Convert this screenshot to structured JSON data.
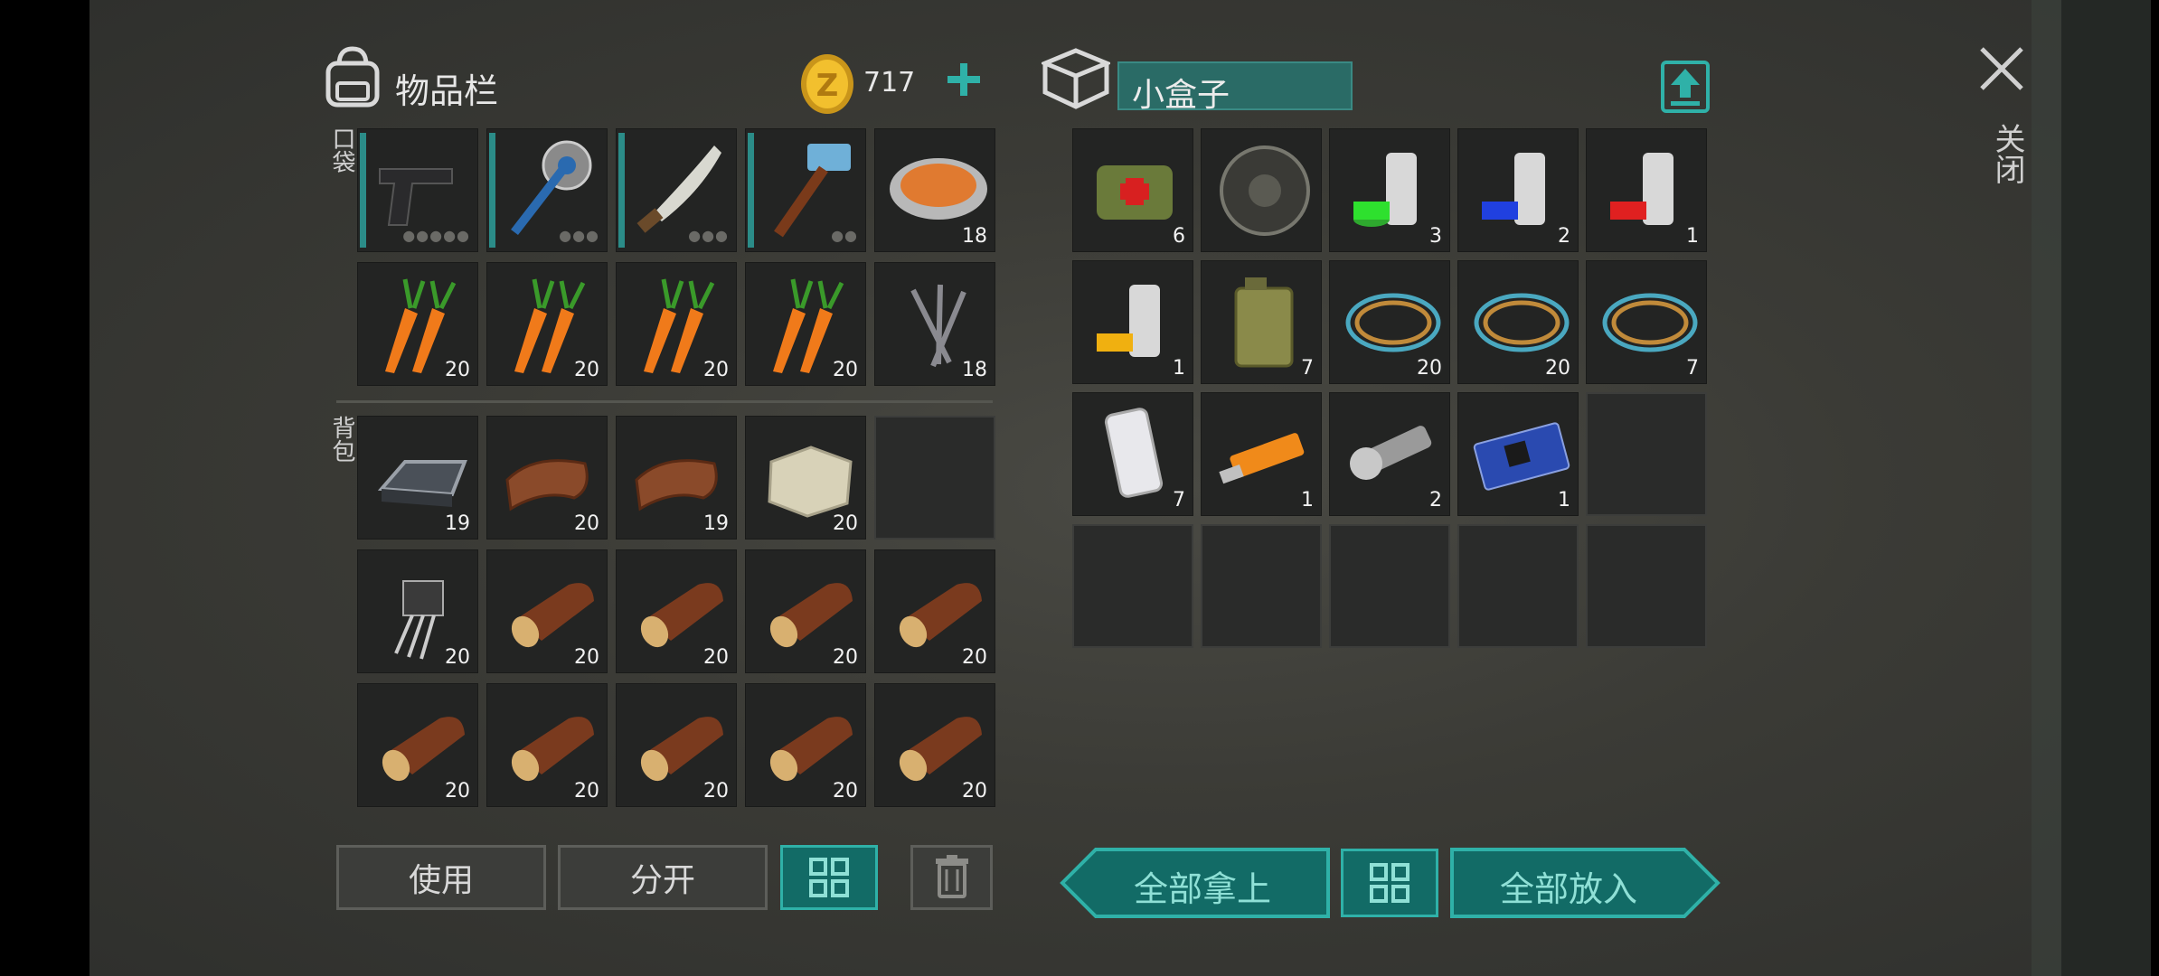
{
  "inventory": {
    "title": "物品栏",
    "coins": "717",
    "pocket_label": "口袋",
    "backpack_label": "背包",
    "pocket": [
      {
        "icon": "pistol-icon",
        "count": ""
      },
      {
        "icon": "saw-blade-mace-icon",
        "count": ""
      },
      {
        "icon": "machete-icon",
        "count": ""
      },
      {
        "icon": "hammer-icon",
        "count": ""
      },
      {
        "icon": "stew-bowl-icon",
        "count": "18"
      },
      {
        "icon": "carrot-icon",
        "count": "20"
      },
      {
        "icon": "carrot-icon",
        "count": "20"
      },
      {
        "icon": "carrot-icon",
        "count": "20"
      },
      {
        "icon": "carrot-icon",
        "count": "20"
      },
      {
        "icon": "nails-icon",
        "count": "18"
      }
    ],
    "backpack": [
      {
        "icon": "iron-ingot-icon",
        "count": "19"
      },
      {
        "icon": "leather-icon",
        "count": "20"
      },
      {
        "icon": "leather-icon",
        "count": "19"
      },
      {
        "icon": "stone-block-icon",
        "count": "20"
      },
      {
        "icon": "",
        "count": ""
      },
      {
        "icon": "transistor-icon",
        "count": "20"
      },
      {
        "icon": "log-icon",
        "count": "20"
      },
      {
        "icon": "log-icon",
        "count": "20"
      },
      {
        "icon": "log-icon",
        "count": "20"
      },
      {
        "icon": "log-icon",
        "count": "20"
      },
      {
        "icon": "log-icon",
        "count": "20"
      },
      {
        "icon": "log-icon",
        "count": "20"
      },
      {
        "icon": "log-icon",
        "count": "20"
      },
      {
        "icon": "log-icon",
        "count": "20"
      },
      {
        "icon": "log-icon",
        "count": "20"
      }
    ],
    "buttons": {
      "use": "使用",
      "split": "分开"
    }
  },
  "container": {
    "name": "小盒子",
    "items": [
      {
        "icon": "first-aid-bag-icon",
        "count": "6"
      },
      {
        "icon": "tire-icon",
        "count": ""
      },
      {
        "icon": "spray-paint-green-icon",
        "count": "3"
      },
      {
        "icon": "spray-paint-blue-icon",
        "count": "2"
      },
      {
        "icon": "spray-paint-red-icon",
        "count": "1"
      },
      {
        "icon": "spray-paint-yellow-icon",
        "count": "1"
      },
      {
        "icon": "jerrycan-icon",
        "count": "7"
      },
      {
        "icon": "wire-coil-icon",
        "count": "20"
      },
      {
        "icon": "wire-coil-icon",
        "count": "20"
      },
      {
        "icon": "wire-coil-icon",
        "count": "7"
      },
      {
        "icon": "smartphone-icon",
        "count": "7"
      },
      {
        "icon": "usb-drive-icon",
        "count": "1"
      },
      {
        "icon": "flashlight-icon",
        "count": "2"
      },
      {
        "icon": "circuit-board-icon",
        "count": "1"
      },
      {
        "icon": "",
        "count": ""
      }
    ],
    "buttons": {
      "take_all": "全部拿上",
      "put_all": "全部放入"
    }
  },
  "close_label": "关闭",
  "colors": {
    "accent": "#2fb1a8",
    "durability": "#2b8c88"
  }
}
